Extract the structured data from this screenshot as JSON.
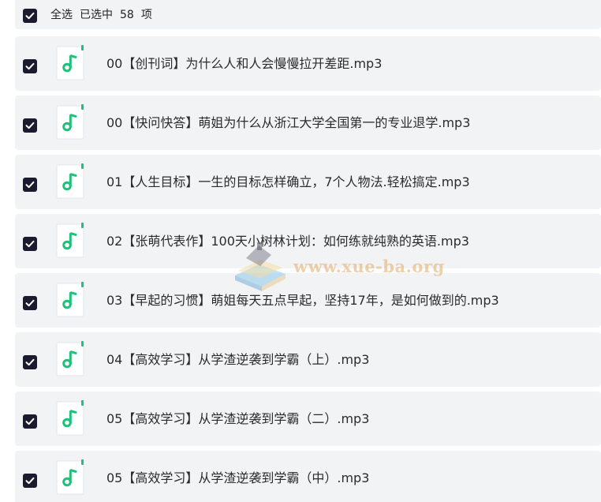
{
  "header": {
    "select_all_label": "全选",
    "selected_prefix": "已选中",
    "selected_count": "58",
    "selected_suffix": "项"
  },
  "files": [
    {
      "name": "00【创刊词】为什么人和人会慢慢拉开差距.mp3",
      "checked": true
    },
    {
      "name": "00【快问快答】萌姐为什么从浙江大学全国第一的专业退学.mp3",
      "checked": true
    },
    {
      "name": "01【人生目标】一生的目标怎样确立，7个人物法.轻松搞定.mp3",
      "checked": true
    },
    {
      "name": "02【张萌代表作】100天小树林计划：如何练就纯熟的英语.mp3",
      "checked": true
    },
    {
      "name": "03【早起的习惯】萌姐每天五点早起，坚持17年，是如何做到的.mp3",
      "checked": true
    },
    {
      "name": "04【高效学习】从学渣逆袭到学霸（上）.mp3",
      "checked": true
    },
    {
      "name": "05【高效学习】从学渣逆袭到学霸（二）.mp3",
      "checked": true
    },
    {
      "name": "05【高效学习】从学渣逆袭到学霸（中）.mp3",
      "checked": true
    }
  ],
  "icons": {
    "checkbox": "checkbox-checked-icon",
    "file": "audio-file-icon"
  },
  "colors": {
    "checkbox_fill": "#1a1b2e",
    "row_background": "#f2f3f5",
    "audio_icon_green": "#1fc07a"
  },
  "watermark": {
    "text": "www.xue-ba.org"
  }
}
